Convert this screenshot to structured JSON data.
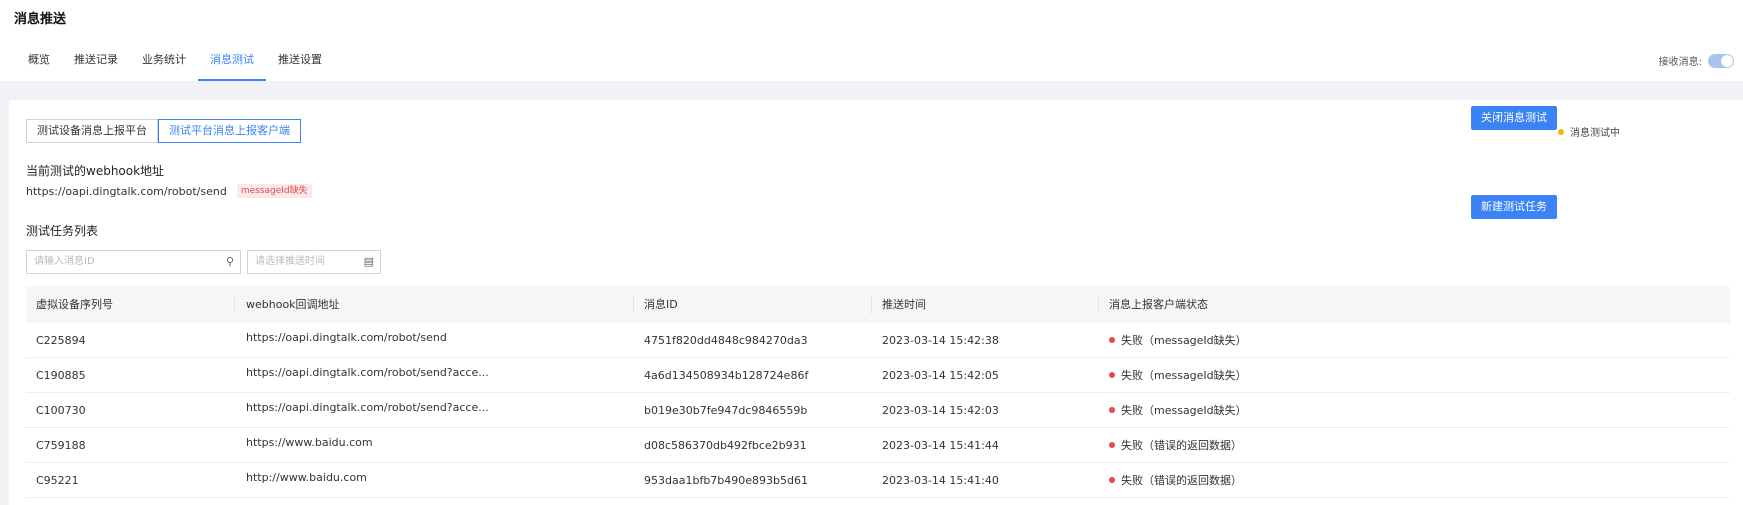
{
  "page": {
    "title": "消息推送"
  },
  "tabs": [
    {
      "label": "概览"
    },
    {
      "label": "推送记录"
    },
    {
      "label": "业务统计"
    },
    {
      "label": "消息测试",
      "active": true
    },
    {
      "label": "推送设置"
    }
  ],
  "receive": {
    "label": "接收消息:",
    "enabled": true
  },
  "segment": {
    "left_label": "测试设备消息上报平台",
    "right_label": "测试平台消息上报客户端",
    "selected": "right"
  },
  "status": {
    "label": "消息测试中",
    "color": "#f5b400"
  },
  "buttons": {
    "close_test": "关闭消息测试",
    "new_task": "新建测试任务"
  },
  "webhook": {
    "title": "当前测试的webhook地址",
    "url": "https://oapi.dingtalk.com/robot/send",
    "tag": "messageId缺失"
  },
  "list": {
    "title": "测试任务列表",
    "search_placeholder": "请输入消息ID",
    "date_placeholder": "请选择推送时间"
  },
  "table": {
    "headers": [
      "虚拟设备序列号",
      "webhook回调地址",
      "消息ID",
      "推送时间",
      "消息上报客户端状态"
    ],
    "rows": [
      {
        "serial": "C225894",
        "webhook": "https://oapi.dingtalk.com/robot/send",
        "msg_id": "4751f820dd4848c984270da3",
        "time": "2023-03-14 15:42:38",
        "status": "失败（messageId缺失）"
      },
      {
        "serial": "C190885",
        "webhook": "https://oapi.dingtalk.com/robot/send?acce...",
        "msg_id": "4a6d134508934b128724e86f",
        "time": "2023-03-14 15:42:05",
        "status": "失败（messageId缺失）"
      },
      {
        "serial": "C100730",
        "webhook": "https://oapi.dingtalk.com/robot/send?acce...",
        "msg_id": "b019e30b7fe947dc9846559b",
        "time": "2023-03-14 15:42:03",
        "status": "失败（messageId缺失）"
      },
      {
        "serial": "C759188",
        "webhook": "https://www.baidu.com",
        "msg_id": "d08c586370db492fbce2b931",
        "time": "2023-03-14 15:41:44",
        "status": "失败（错误的返回数据）"
      },
      {
        "serial": "C95221",
        "webhook": "http://www.baidu.com",
        "msg_id": "953daa1bfb7b490e893b5d61",
        "time": "2023-03-14 15:41:40",
        "status": "失败（错误的返回数据）"
      }
    ]
  },
  "colors": {
    "accent": "#3b82f6",
    "fail": "#e5484d",
    "warning": "#f5b400"
  }
}
